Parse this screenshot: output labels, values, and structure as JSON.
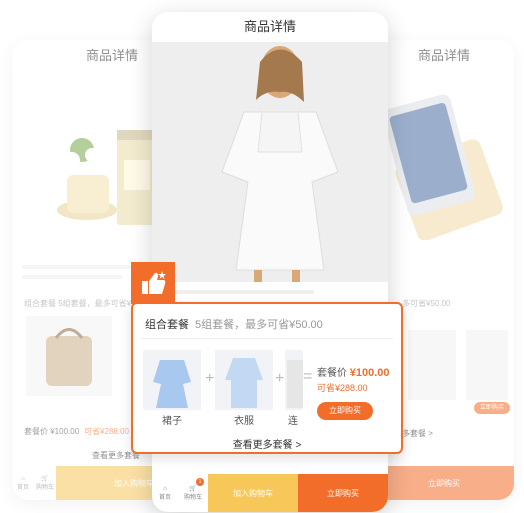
{
  "screen_title": "商品详情",
  "left_phone": {
    "title": "商品详情",
    "bundle_text": "组合套餐",
    "bundle_sub": "5组套餐，最多可省¥50.00",
    "price_label": "套餐价 ¥100.00",
    "save_label": "可省¥288.00",
    "more": "查看更多套餐",
    "home": "首页",
    "cart": "购物车",
    "add_cart": "加入购物车"
  },
  "right_phone": {
    "title": "商品详情",
    "bundle_sub": "多可省¥50.00",
    "buy_now": "立即购买",
    "more": "更多套餐 >",
    "buy": "立即购买"
  },
  "center_phone": {
    "title": "商品详情",
    "home": "首页",
    "cart": "购物车",
    "cart_badge": "1",
    "add_cart": "加入购物车",
    "buy_now": "立即购买"
  },
  "popup": {
    "title": "组合套餐",
    "subtitle": "5组套餐，最多可省¥50.00",
    "items": [
      "裙子",
      "衣服",
      "连"
    ],
    "price_label": "套餐价",
    "price_value": "¥100.00",
    "save": "可省¥288.00",
    "buy_now": "立即购买",
    "more": "查看更多套餐 >"
  },
  "colors": {
    "accent": "#f26d2a",
    "yellow": "#f7c75a"
  }
}
